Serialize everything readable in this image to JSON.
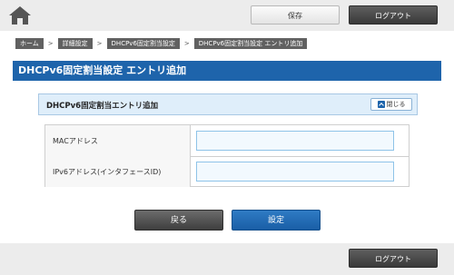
{
  "header": {
    "home_icon": "home-icon",
    "save_label": "保存",
    "logout_label": "ログアウト"
  },
  "breadcrumb": [
    {
      "label": "ホーム"
    },
    {
      "label": "詳細設定"
    },
    {
      "label": "DHCPv6固定割当設定"
    },
    {
      "label": "DHCPv6固定割当設定 エントリ追加"
    }
  ],
  "breadcrumb_separator": ">",
  "page": {
    "title": "DHCPv6固定割当設定 エントリ追加"
  },
  "panel": {
    "title": "DHCPv6固定割当エントリ追加",
    "close_label": "閉じる"
  },
  "form": {
    "mac_label": "MACアドレス",
    "mac_value": "",
    "ipv6_label": "IPv6アドレス(インタフェースID)",
    "ipv6_value": ""
  },
  "actions": {
    "back_label": "戻る",
    "set_label": "設定"
  },
  "footer": {
    "logout_label": "ログアウト"
  },
  "colors": {
    "title_bar": "#1e64ab",
    "panel_bg": "#dfeefa",
    "primary_button": "#1a5ea6"
  }
}
